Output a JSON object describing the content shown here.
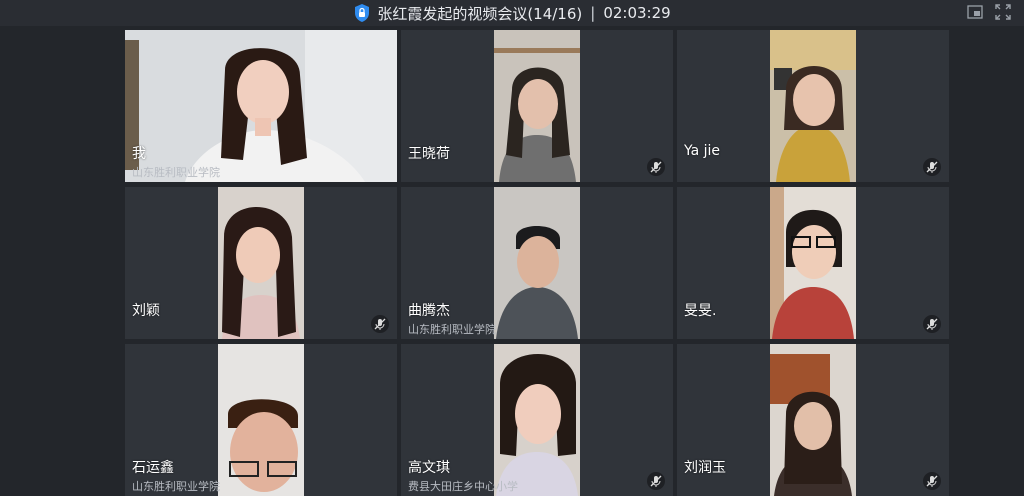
{
  "meeting": {
    "title": "张红霞发起的视频会议(14/16)",
    "separator": "|",
    "elapsed": "02:03:29",
    "secure_icon": "shield-lock-icon",
    "window_icons": [
      "picture-in-picture-icon",
      "fullscreen-icon"
    ]
  },
  "participants": [
    {
      "name": "我",
      "org": "山东胜利职业学院",
      "muted": false
    },
    {
      "name": "王晓荷",
      "org": "",
      "muted": true
    },
    {
      "name": "Ya jie",
      "org": "",
      "muted": true
    },
    {
      "name": "刘颖",
      "org": "",
      "muted": true
    },
    {
      "name": "曲腾杰",
      "org": "山东胜利职业学院",
      "muted": false
    },
    {
      "name": "旻旻.",
      "org": "",
      "muted": true
    },
    {
      "name": "石运鑫",
      "org": "山东胜利职业学院",
      "muted": false
    },
    {
      "name": "高文琪",
      "org": "费县大田庄乡中心小学",
      "muted": true
    },
    {
      "name": "刘润玉",
      "org": "",
      "muted": true
    }
  ]
}
